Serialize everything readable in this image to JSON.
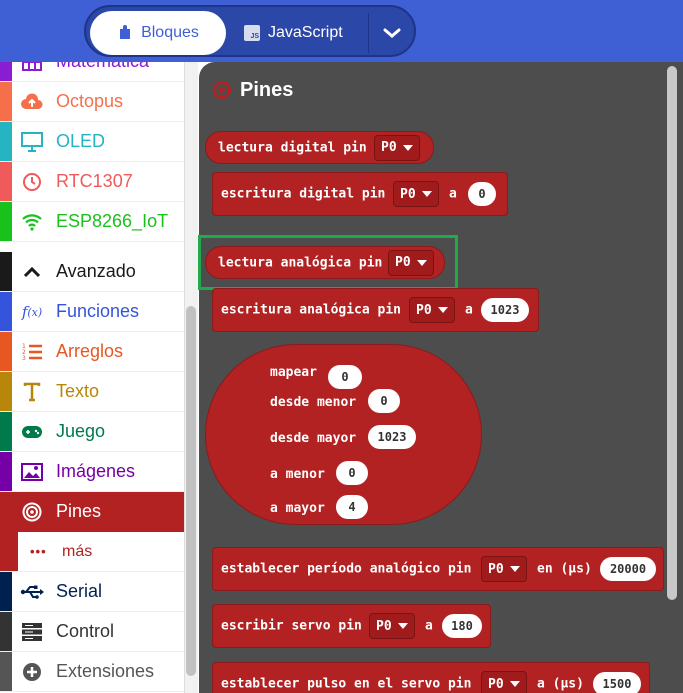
{
  "header": {
    "blocks_label": "Bloques",
    "js_badge": "JS",
    "js_label": "JavaScript"
  },
  "sidebar": {
    "items": [
      {
        "label": "Matemática",
        "color": "#8a1cd1"
      },
      {
        "label": "Octopus",
        "color": "#f5704a"
      },
      {
        "label": "OLED",
        "color": "#26b3c2"
      },
      {
        "label": "RTC1307",
        "color": "#f05a5a"
      },
      {
        "label": "ESP8266_IoT",
        "color": "#19c21b"
      },
      {
        "label": "Avanzado",
        "color": "#1a1a1a"
      },
      {
        "label": "Funciones",
        "color": "#3455db"
      },
      {
        "label": "Arreglos",
        "color": "#e65722"
      },
      {
        "label": "Texto",
        "color": "#b8860b"
      },
      {
        "label": "Juego",
        "color": "#007a4b"
      },
      {
        "label": "Imágenes",
        "color": "#7600a8"
      },
      {
        "label": "Pines",
        "color": "#b22222"
      },
      {
        "label": "más",
        "color": "#b22222"
      },
      {
        "label": "Serial",
        "color": "#002050"
      },
      {
        "label": "Control",
        "color": "#333333"
      },
      {
        "label": "Extensiones",
        "color": "#555555"
      }
    ],
    "more_dots": "•••"
  },
  "workspace": {
    "title": "Pines",
    "pin_value": "P0",
    "blocks": {
      "digital_read": "lectura digital pin",
      "digital_write": "escritura digital pin",
      "digital_write_a": "a",
      "digital_write_value": "0",
      "analog_read": "lectura analógica pin",
      "analog_write": "escritura analógica pin",
      "analog_write_a": "a",
      "analog_write_value": "1023",
      "map": {
        "map_label": "mapear",
        "map_value": "0",
        "from_low_label": "desde menor",
        "from_low_value": "0",
        "from_high_label": "desde mayor",
        "from_high_value": "1023",
        "to_low_label": "a menor",
        "to_low_value": "0",
        "to_high_label": "a mayor",
        "to_high_value": "4"
      },
      "set_period": "establecer período analógico pin",
      "set_period_in": "en (µs)",
      "set_period_value": "20000",
      "servo_write": "escribir servo pin",
      "servo_write_a": "a",
      "servo_write_value": "180",
      "servo_pulse": "establecer pulso en el servo pin",
      "servo_pulse_a": "a (µs)",
      "servo_pulse_value": "1500"
    }
  }
}
